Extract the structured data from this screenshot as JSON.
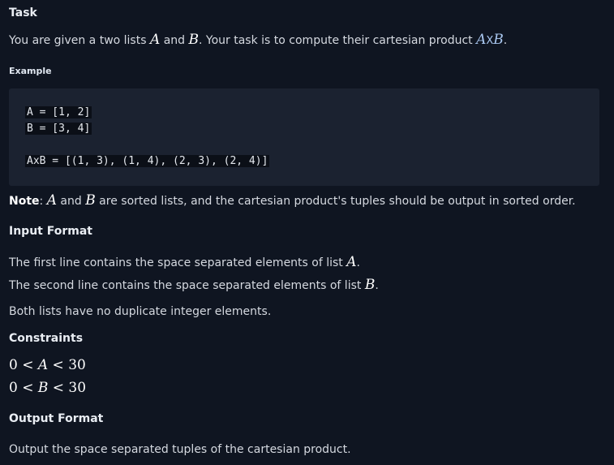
{
  "task": {
    "heading": "Task",
    "line_pre": "You are given a two lists ",
    "var_a": "A",
    "line_and": " and ",
    "var_b": "B",
    "line_post": ". Your task is to compute their cartesian product ",
    "prod_a": "A",
    "prod_x": "X",
    "prod_b": "B",
    "prod_dot": "."
  },
  "example": {
    "heading": "Example",
    "code_lines": [
      "A = [1, 2]",
      "B = [3, 4]",
      "AxB = [(1, 3), (1, 4), (2, 3), (2, 4)]"
    ]
  },
  "note": {
    "label": "Note",
    "colon": ": ",
    "var_a": "A",
    "and": " and ",
    "var_b": "B",
    "rest": " are sorted lists, and the cartesian product's tuples should be output in sorted order."
  },
  "input_format": {
    "heading": "Input Format",
    "line1_pre": "The first line contains the space separated elements of list ",
    "line1_var": "A",
    "line1_post": ".",
    "line2_pre": "The second line contains the space separated elements of list ",
    "line2_var": "B",
    "line2_post": ".",
    "line3": "Both lists have no duplicate integer elements."
  },
  "constraints": {
    "heading": "Constraints",
    "c1_left": "0 < ",
    "c1_var": "A",
    "c1_right": " < 30",
    "c2_left": "0 < ",
    "c2_var": "B",
    "c2_right": " < 30"
  },
  "output_format": {
    "heading": "Output Format",
    "line": "Output the space separated tuples of the cartesian product."
  }
}
